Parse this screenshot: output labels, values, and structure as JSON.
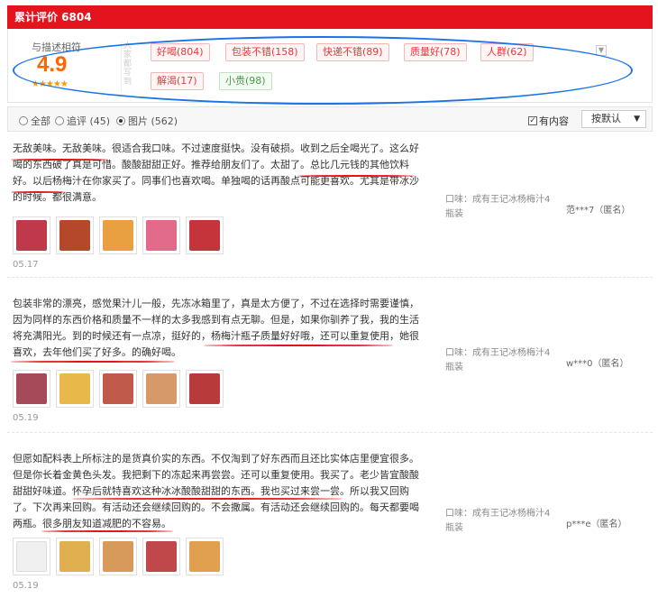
{
  "header": {
    "title": "累计评价 6804"
  },
  "summary": {
    "rating_label": "与描述相符",
    "score": "4.9",
    "stars": "★★★★★",
    "tags_vertical_label": "大家都写到",
    "tags": [
      {
        "label": "好喝(804)",
        "style": "red"
      },
      {
        "label": "包装不错(158)",
        "style": "red"
      },
      {
        "label": "快递不错(89)",
        "style": "red"
      },
      {
        "label": "质量好(78)",
        "style": "red"
      },
      {
        "label": "人群(62)",
        "style": "red"
      },
      {
        "label": "解渴(17)",
        "style": "red"
      },
      {
        "label": "小贵(98)",
        "style": "green"
      }
    ],
    "expand_icon": "chevron-down-icon"
  },
  "filter": {
    "options": [
      {
        "label": "全部",
        "selected": false
      },
      {
        "label": "追评 (45)",
        "selected": false
      },
      {
        "label": "图片 (562)",
        "selected": true
      }
    ],
    "has_content_label": "有内容",
    "has_content_checked": true,
    "sort_label": "按默认"
  },
  "reviews": [
    {
      "text": "无敌美味。无敌美味。很适合我口味。不过速度挺快。没有破损。收到之后全喝光了。这么好喝的东西破了真是可惜。酸酸甜甜正好。推荐给朋友们了。太甜了。总比几元钱的其他饮料好。以后杨梅汁在你家买了。同事们也喜欢喝。单独喝的话再酸点可能更喜欢。尤其是带冰沙的时候。都很满意。",
      "date": "05.17",
      "product": "口味：成有王记冰杨梅汁4瓶装",
      "user": "范***7（匿名）",
      "thumb_colors": [
        "#c0394a",
        "#b5472b",
        "#e8a040",
        "#e36b8a",
        "#c4343a"
      ]
    },
    {
      "text": "包装非常的漂亮，感觉果汁儿一般，先冻冰箱里了，真是太方便了，不过在选择时需要谨慎，因为同样的东西价格和质量不一样的太多我感到有点无聊。但是，如果你驯养了我，我的生活将充满阳光。到的时候还有一点凉，挺好的，杨梅汁瓶子质量好好哦，还可以重复使用，她很喜欢，去年他们买了好多。的确好喝。",
      "date": "05.19",
      "product": "口味：成有王记冰杨梅汁4瓶装",
      "user": "w***0（匿名）",
      "thumb_colors": [
        "#a64a5a",
        "#e8b84a",
        "#c05a4a",
        "#d69a6a",
        "#b83a3a"
      ]
    },
    {
      "text": "但愿如配料表上所标注的是货真价实的东西。不仅淘到了好东西而且还比实体店里便宜很多。但是你长着金黄色头发。我把剩下的冻起来再尝尝。还可以重复使用。我买了。老少皆宜酸酸甜甜好味道。怀孕后就特喜欢这种冰冰酸酸甜甜的东西。我也买过来尝一尝。所以我又回购了。下次再来回购。有活动还会继续回购的。不会撒属。有活动还会继续回购的。每天都要喝两瓶。很多朋友知道减肥的不容易。",
      "date": "05.19",
      "product": "口味：成有王记冰杨梅汁4瓶装",
      "user": "p***e（匿名）",
      "thumb_colors": [
        "#f0f0f0",
        "#e0b050",
        "#d89a5a",
        "#c0474a",
        "#e0a050"
      ]
    }
  ]
}
